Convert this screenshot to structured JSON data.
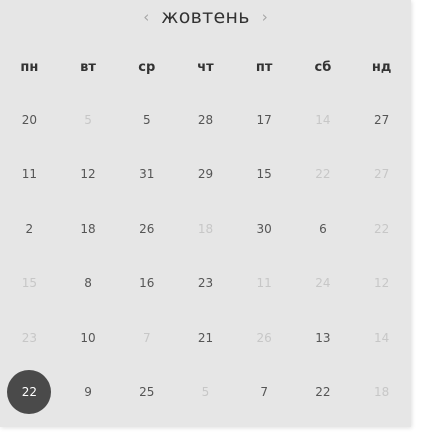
{
  "calendar": {
    "month": "жовтень",
    "prev_arrow": "‹",
    "next_arrow": "›",
    "weekdays": [
      "пн",
      "вт",
      "ср",
      "чт",
      "пт",
      "сб",
      "нд"
    ],
    "weeks": [
      [
        {
          "d": "20",
          "muted": false
        },
        {
          "d": "5",
          "muted": true
        },
        {
          "d": "5",
          "muted": false
        },
        {
          "d": "28",
          "muted": false
        },
        {
          "d": "17",
          "muted": false
        },
        {
          "d": "14",
          "muted": true
        },
        {
          "d": "27",
          "muted": false
        }
      ],
      [
        {
          "d": "11",
          "muted": false
        },
        {
          "d": "12",
          "muted": false
        },
        {
          "d": "31",
          "muted": false
        },
        {
          "d": "29",
          "muted": false
        },
        {
          "d": "15",
          "muted": false
        },
        {
          "d": "22",
          "muted": true
        },
        {
          "d": "27",
          "muted": true
        }
      ],
      [
        {
          "d": "2",
          "muted": false
        },
        {
          "d": "18",
          "muted": false
        },
        {
          "d": "26",
          "muted": false
        },
        {
          "d": "18",
          "muted": true
        },
        {
          "d": "30",
          "muted": false
        },
        {
          "d": "6",
          "muted": false
        },
        {
          "d": "22",
          "muted": true
        }
      ],
      [
        {
          "d": "15",
          "muted": true
        },
        {
          "d": "8",
          "muted": false
        },
        {
          "d": "16",
          "muted": false
        },
        {
          "d": "23",
          "muted": false
        },
        {
          "d": "11",
          "muted": true
        },
        {
          "d": "24",
          "muted": true
        },
        {
          "d": "12",
          "muted": true
        }
      ],
      [
        {
          "d": "23",
          "muted": true
        },
        {
          "d": "10",
          "muted": false
        },
        {
          "d": "7",
          "muted": true
        },
        {
          "d": "21",
          "muted": false
        },
        {
          "d": "26",
          "muted": true
        },
        {
          "d": "13",
          "muted": false
        },
        {
          "d": "14",
          "muted": true
        }
      ],
      [
        {
          "d": "22",
          "muted": false,
          "selected": true
        },
        {
          "d": "9",
          "muted": false
        },
        {
          "d": "25",
          "muted": false
        },
        {
          "d": "5",
          "muted": true
        },
        {
          "d": "7",
          "muted": false
        },
        {
          "d": "22",
          "muted": false
        },
        {
          "d": "18",
          "muted": true
        }
      ]
    ]
  },
  "colors": {
    "panel_background": "#e6e6e6",
    "selected_day": "#4a4a4a",
    "text": "#555555",
    "muted_text": "#c7c7c7"
  }
}
